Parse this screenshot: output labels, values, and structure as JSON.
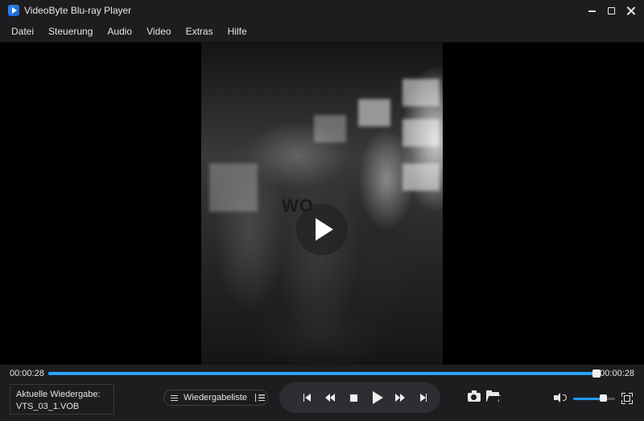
{
  "window": {
    "title": "VideoByte Blu-ray Player",
    "logo_icon": "videobyte-logo-icon",
    "accent_color": "#1e9bff"
  },
  "menu": {
    "items": [
      {
        "label": "Datei"
      },
      {
        "label": "Steuerung"
      },
      {
        "label": "Audio"
      },
      {
        "label": "Video"
      },
      {
        "label": "Extras"
      },
      {
        "label": "Hilfe"
      }
    ]
  },
  "video": {
    "watermark_text": "WO",
    "overlay_icon": "play-icon"
  },
  "playback": {
    "current_time": "00:00:28",
    "total_time": "00:00:28",
    "progress_fraction": 1.0,
    "now_playing_label": "Aktuelle Wiedergabe:",
    "now_playing_file": "VTS_03_1.VOB",
    "playlist_label": "Wiedergabeliste",
    "volume_fraction": 0.72
  },
  "controls": {
    "transport_icons": [
      "skip-previous-icon",
      "rewind-icon",
      "stop-icon",
      "play-icon",
      "fast-forward-icon",
      "skip-next-icon"
    ],
    "extra_icons": [
      "camera-icon",
      "folder-icon",
      "volume-icon",
      "fullscreen-icon"
    ]
  }
}
